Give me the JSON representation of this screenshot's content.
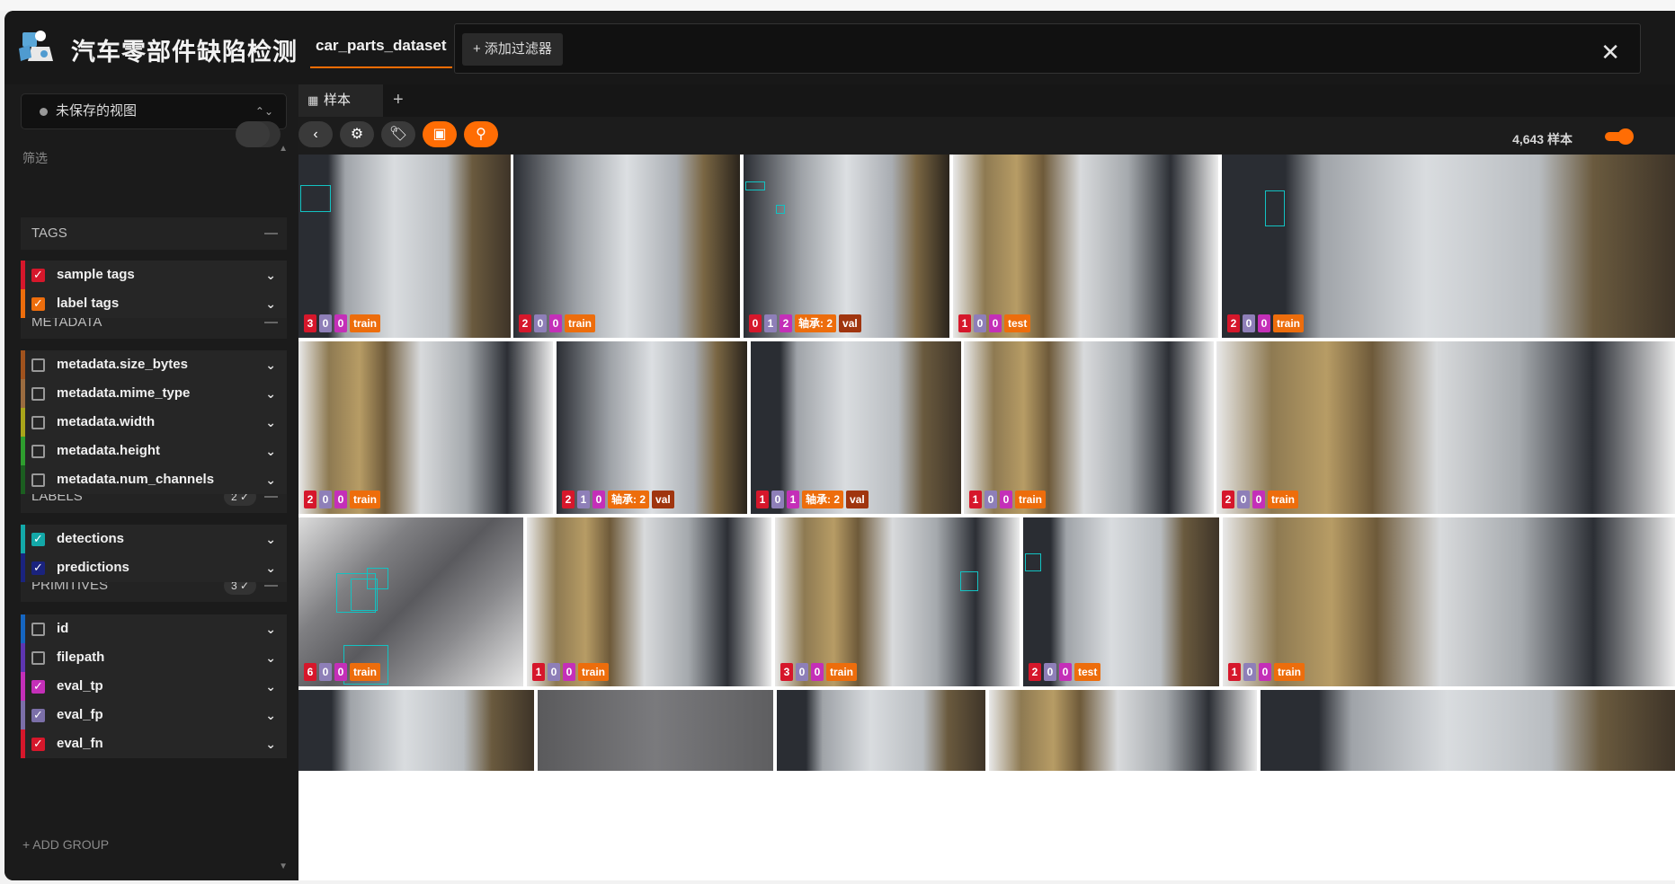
{
  "header": {
    "app_title": "汽车零部件缺陷检测",
    "dataset_name": "car_parts_dataset",
    "add_filter_label": "+ 添加过滤器",
    "close_glyph": "✕"
  },
  "sidebar": {
    "view_select_label": "未保存的视图",
    "filter_title": "筛选",
    "add_group_label": "+ ADD GROUP",
    "groups": [
      {
        "label": "TAGS",
        "badge": ""
      },
      {
        "label": "METADATA",
        "badge": ""
      },
      {
        "label": "LABELS",
        "badge": "2 ✓"
      },
      {
        "label": "PRIMITIVES",
        "badge": "3 ✓"
      }
    ],
    "fields": [
      {
        "label": "sample tags",
        "checked": true,
        "color": "#d6172b"
      },
      {
        "label": "label tags",
        "checked": true,
        "color": "#ed6d0c"
      },
      {
        "label": "metadata.size_bytes",
        "checked": false,
        "color": "#a0521d"
      },
      {
        "label": "metadata.mime_type",
        "checked": false,
        "color": "#9a6b3f"
      },
      {
        "label": "metadata.width",
        "checked": false,
        "color": "#a8a51a"
      },
      {
        "label": "metadata.height",
        "checked": false,
        "color": "#2e9e2e"
      },
      {
        "label": "metadata.num_channels",
        "checked": false,
        "color": "#1b5e20"
      },
      {
        "label": "detections",
        "checked": true,
        "color": "#13a8a8"
      },
      {
        "label": "predictions",
        "checked": true,
        "color": "#1a237e"
      },
      {
        "label": "id",
        "checked": false,
        "color": "#1565c0"
      },
      {
        "label": "filepath",
        "checked": false,
        "color": "#5e35b1"
      },
      {
        "label": "eval_tp",
        "checked": true,
        "color": "#c42fb8"
      },
      {
        "label": "eval_fp",
        "checked": true,
        "color": "#7b6fa8"
      },
      {
        "label": "eval_fn",
        "checked": true,
        "color": "#d6172b"
      }
    ]
  },
  "main": {
    "tab_label": "样本",
    "tab_add": "+",
    "sample_count": "4,643 样本"
  },
  "colors": {
    "accent": "#ff6d04",
    "detection_box": "#13c2c2"
  },
  "tiles": [
    {
      "pills": [
        [
          "gt",
          "3"
        ],
        [
          "pred",
          "0"
        ],
        [
          "tag",
          "0"
        ],
        [
          "split",
          "train"
        ]
      ]
    },
    {
      "pills": [
        [
          "gt",
          "2"
        ],
        [
          "pred",
          "0"
        ],
        [
          "tag",
          "0"
        ],
        [
          "split",
          "train"
        ]
      ]
    },
    {
      "pills": [
        [
          "gt",
          "0"
        ],
        [
          "pred",
          "1"
        ],
        [
          "tag",
          "2"
        ],
        [
          "label",
          "轴承: 2"
        ],
        [
          "val",
          "val"
        ]
      ]
    },
    {
      "pills": [
        [
          "gt",
          "1"
        ],
        [
          "pred",
          "0"
        ],
        [
          "tag",
          "0"
        ],
        [
          "split",
          "test"
        ]
      ]
    },
    {
      "pills": [
        [
          "gt",
          "2"
        ],
        [
          "pred",
          "0"
        ],
        [
          "tag",
          "0"
        ],
        [
          "split",
          "train"
        ]
      ]
    },
    {
      "pills": [
        [
          "gt",
          "2"
        ],
        [
          "pred",
          "0"
        ],
        [
          "tag",
          "0"
        ],
        [
          "split",
          "train"
        ]
      ]
    },
    {
      "pills": [
        [
          "gt",
          "2"
        ],
        [
          "pred",
          "1"
        ],
        [
          "tag",
          "0"
        ],
        [
          "label",
          "轴承: 2"
        ],
        [
          "val",
          "val"
        ]
      ]
    },
    {
      "pills": [
        [
          "gt",
          "1"
        ],
        [
          "pred",
          "0"
        ],
        [
          "tag",
          "1"
        ],
        [
          "label",
          "轴承: 2"
        ],
        [
          "val",
          "val"
        ]
      ]
    },
    {
      "pills": [
        [
          "gt",
          "1"
        ],
        [
          "pred",
          "0"
        ],
        [
          "tag",
          "0"
        ],
        [
          "split",
          "train"
        ]
      ]
    },
    {
      "pills": [
        [
          "gt",
          "2"
        ],
        [
          "pred",
          "0"
        ],
        [
          "tag",
          "0"
        ],
        [
          "split",
          "train"
        ]
      ]
    },
    {
      "pills": [
        [
          "gt",
          "6"
        ],
        [
          "pred",
          "0"
        ],
        [
          "tag",
          "0"
        ],
        [
          "split",
          "train"
        ]
      ]
    },
    {
      "pills": [
        [
          "gt",
          "1"
        ],
        [
          "pred",
          "0"
        ],
        [
          "tag",
          "0"
        ],
        [
          "split",
          "train"
        ]
      ]
    },
    {
      "pills": [
        [
          "gt",
          "3"
        ],
        [
          "pred",
          "0"
        ],
        [
          "tag",
          "0"
        ],
        [
          "split",
          "train"
        ]
      ]
    },
    {
      "pills": [
        [
          "gt",
          "2"
        ],
        [
          "pred",
          "0"
        ],
        [
          "tag",
          "0"
        ],
        [
          "split",
          "test"
        ]
      ]
    },
    {
      "pills": [
        [
          "gt",
          "1"
        ],
        [
          "pred",
          "0"
        ],
        [
          "tag",
          "0"
        ],
        [
          "split",
          "train"
        ]
      ]
    },
    {
      "pills": []
    },
    {
      "pills": []
    },
    {
      "pills": []
    },
    {
      "pills": []
    },
    {
      "pills": []
    }
  ]
}
